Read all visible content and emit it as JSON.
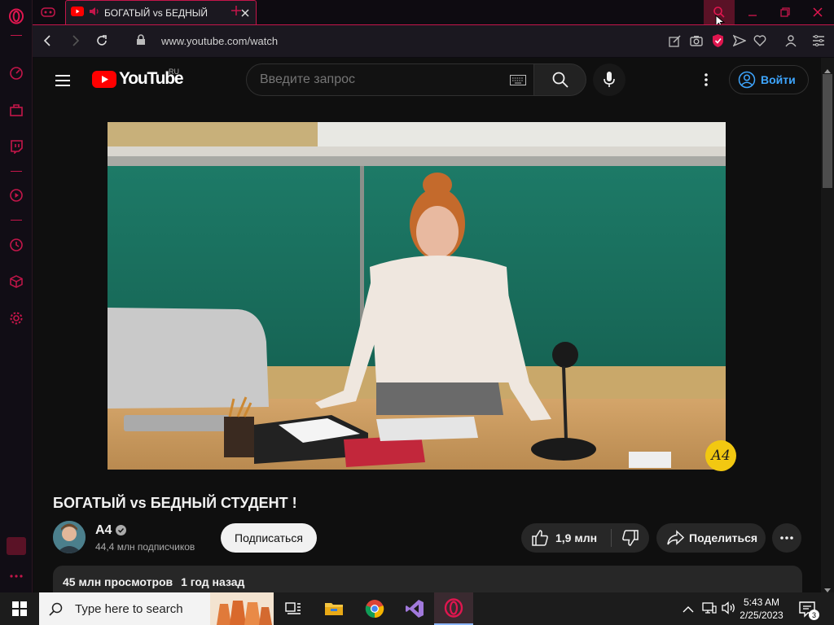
{
  "browser": {
    "tab": {
      "title": "БОГАТЫЙ vs БЕДНЫЙ СТУДЕНТ !"
    },
    "address": {
      "url": "www.youtube.com/watch"
    },
    "colors": {
      "accent": "#c4164a",
      "youtube_red": "#ff0000",
      "link_blue": "#3ea6ff"
    }
  },
  "sidebar": {
    "icons": [
      "opera-logo",
      "speed-dial-icon",
      "shopping-icon",
      "twitch-icon",
      "player-icon",
      "history-icon",
      "extensions-icon",
      "settings-icon",
      "more-icon"
    ]
  },
  "youtube": {
    "logo_text": "YouTube",
    "region": "RU",
    "search_placeholder": "Введите запрос",
    "signin_label": "Войти"
  },
  "video": {
    "title": "БОГАТЫЙ vs БЕДНЫЙ СТУДЕНТ !",
    "watermark": "А4",
    "channel": "А4",
    "subscribers": "44,4 млн подписчиков",
    "subscribe_label": "Подписаться",
    "likes": "1,9 млн",
    "share_label": "Поделиться",
    "views": "45 млн просмотров",
    "published": "1 год назад"
  },
  "taskbar": {
    "search_placeholder": "Type here to search",
    "time": "5:43 AM",
    "date": "2/25/2023",
    "notifications": "3",
    "apps": [
      "task-view",
      "file-explorer",
      "chrome",
      "visual-studio",
      "opera-gx"
    ]
  }
}
